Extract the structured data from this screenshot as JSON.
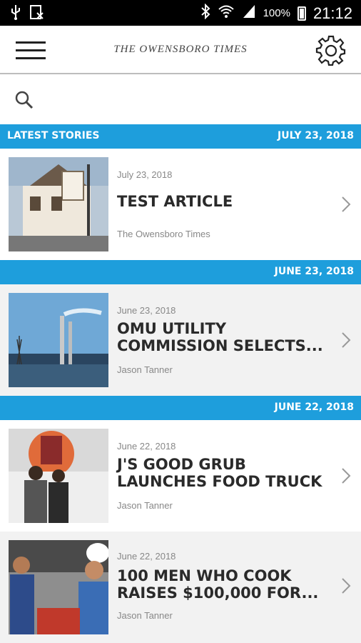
{
  "status_bar": {
    "battery": "100%",
    "time": "21:12"
  },
  "app_bar": {
    "brand": "THE OWENSBORO TIMES"
  },
  "section": {
    "label": "LATEST STORIES"
  },
  "groups": [
    {
      "date_header": "JULY 23, 2018"
    },
    {
      "date_header": "JUNE 23, 2018"
    },
    {
      "date_header": "JUNE 22, 2018"
    }
  ],
  "stories": [
    {
      "date": "July 23, 2018",
      "title": "TEST ARTICLE",
      "author": "The Owensboro Times"
    },
    {
      "date": "June 23, 2018",
      "title": "OMU UTILITY COMMISSION SELECTS...",
      "author": "Jason Tanner"
    },
    {
      "date": "June 22, 2018",
      "title": "J'S GOOD GRUB LAUNCHES FOOD TRUCK",
      "author": "Jason Tanner"
    },
    {
      "date": "June 22, 2018",
      "title": "100 MEN WHO COOK RAISES $100,000 FOR...",
      "author": "Jason Tanner"
    }
  ],
  "colors": {
    "accent": "#1e9edc",
    "text": "#2a2a2a",
    "muted": "#888888"
  },
  "icons": [
    "usb-icon",
    "image-icon",
    "bluetooth-icon",
    "wifi-icon",
    "signal-icon",
    "battery-icon",
    "menu-icon",
    "gear-icon",
    "search-icon",
    "chevron-right-icon"
  ]
}
